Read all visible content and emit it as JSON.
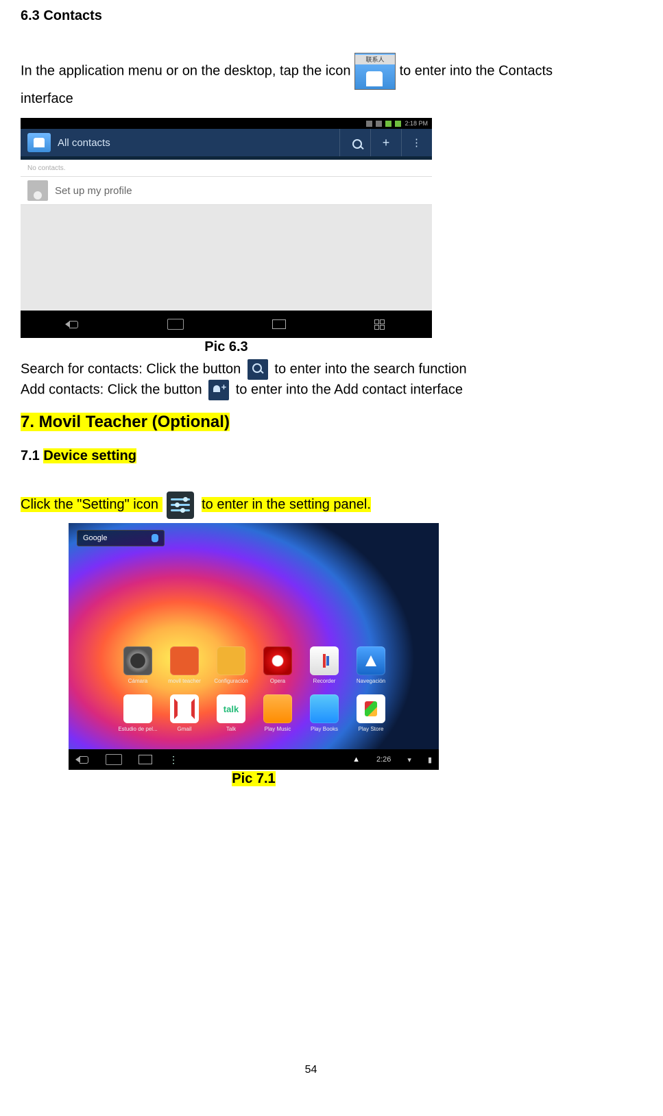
{
  "heading63": "6.3 Contacts",
  "intro": {
    "pre": "In the application menu or on the desktop, tap the icon ",
    "post": "to enter into the Contacts interface"
  },
  "shot1": {
    "statusbar_time": "2:18 PM",
    "actionbar_title": "All contacts",
    "nocontacts": "No contacts.",
    "profile": "Set up my profile"
  },
  "caption63": "Pic 6.3",
  "search_line": {
    "pre": "Search for contacts: Click the button ",
    "post": " to enter into the search function"
  },
  "add_line": {
    "pre": "Add contacts: Click the button",
    "post": " to enter into the Add contact interface"
  },
  "heading7": "7. Movil Teacher (Optional)  ",
  "heading71_prefix": "7.1 ",
  "heading71_main": "Device setting",
  "setting_line": {
    "pre": "Click the \"Setting\" icon ",
    "post": " to enter in the setting panel."
  },
  "shot2": {
    "search_label": "Google",
    "row1_labels": [
      "Cámara",
      "movil teacher",
      "Configuración",
      "Opera",
      "Recorder",
      "Navegación"
    ],
    "row2_labels": [
      "Estudio de pel...",
      "Gmail",
      "Talk",
      "Play Music",
      "Play Books",
      "Play Store"
    ],
    "talk_text": "talk",
    "sys_time": "2:26"
  },
  "caption71": "Pic 7.1",
  "page_number": "54"
}
